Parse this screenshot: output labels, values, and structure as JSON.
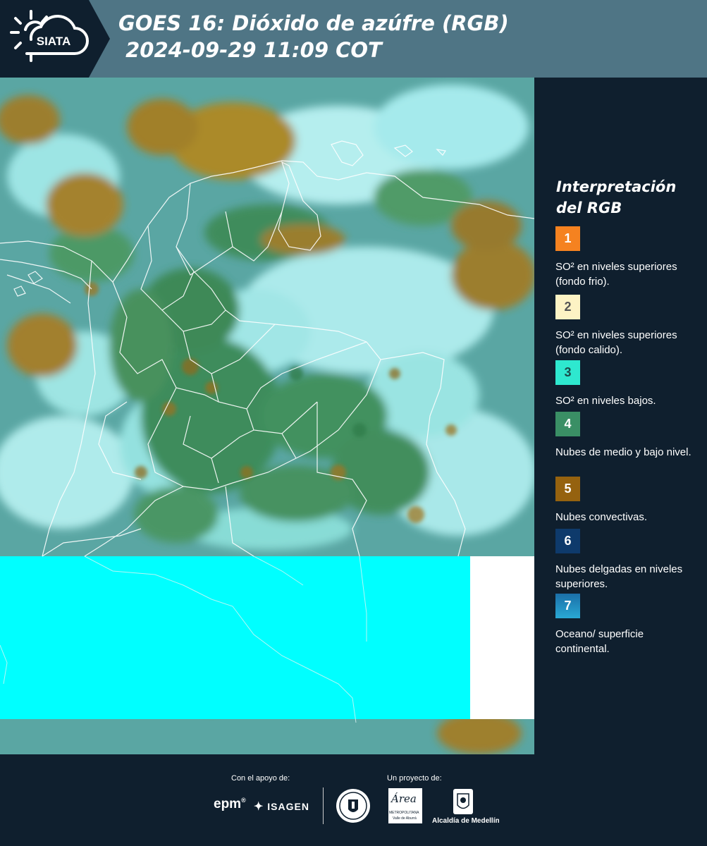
{
  "header": {
    "logo_text": "SIATA",
    "title": "GOES 16: Dióxido de azúfre (RGB)\n 2024-09-29 11:09 COT"
  },
  "legend": {
    "title": "Interpretación del RGB",
    "items": [
      {
        "number": "1",
        "color": "#f58220",
        "text": "SO² en niveles superiores (fondo frio)."
      },
      {
        "number": "2",
        "color": "#fdf3c4",
        "number_color": "#555555",
        "text": "SO² en niveles superiores (fondo calido)."
      },
      {
        "number": "3",
        "color": "#2ee8cf",
        "number_color": "#1b4b4b",
        "text": "SO² en niveles bajos."
      },
      {
        "number": "4",
        "color": "#3a8f65",
        "text": "Nubes de medio y bajo nivel."
      },
      {
        "number": "5",
        "color": "#95620f",
        "text": "Nubes convectivas."
      },
      {
        "number": "6",
        "color": "#0e3a6b",
        "text": "Nubes delgadas en niveles superiores."
      },
      {
        "number": "7",
        "color": "#1f8fbf",
        "text": "Oceano/ superficie continental."
      }
    ]
  },
  "footer": {
    "support_label": "Con el apoyo de:",
    "project_label": "Un proyecto de:",
    "epm": "epm",
    "isagen": "ISAGEN",
    "area_text": "METROPOLITANA",
    "area_sub": "Valle de Aburrá",
    "area_script": "Área",
    "alcaldia": "Alcaldía de Medellín"
  }
}
